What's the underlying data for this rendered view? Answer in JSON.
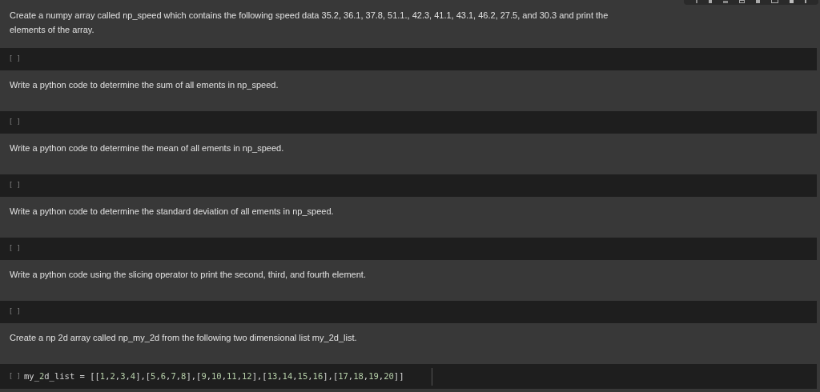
{
  "cells": [
    {
      "kind": "text",
      "text": "Create a numpy array called np_speed which contains the following speed data 35.2, 36.1, 37.8, 51.1., 42.3, 41.1, 43.1, 46.2, 27.5, and 30.3 and print the elements of the array."
    },
    {
      "kind": "code",
      "run_label": "[ ]"
    },
    {
      "kind": "text",
      "text": "Write a python code to determine the sum of all ements in np_speed."
    },
    {
      "kind": "code",
      "run_label": "[ ]"
    },
    {
      "kind": "text",
      "text": "Write a python code to determine the mean of all ements in np_speed."
    },
    {
      "kind": "code",
      "run_label": "[ ]"
    },
    {
      "kind": "text",
      "text": "Write a python code to determine the standard deviation of all ements in np_speed."
    },
    {
      "kind": "code",
      "run_label": "[ ]"
    },
    {
      "kind": "text",
      "text": "Write a python code using the slicing operator to print the second, third, and fourth element."
    },
    {
      "kind": "code",
      "run_label": "[ ]"
    },
    {
      "kind": "text",
      "text": "Create a np 2d array called np_my_2d from the following two dimensional list my_2d_list."
    },
    {
      "kind": "code",
      "run_label": "[ ]",
      "code": "my_2d_list = [[1,2,3,4],[5,6,7,8],[9,10,11,12],[13,14,15,16],[17,18,19,20]]"
    }
  ]
}
